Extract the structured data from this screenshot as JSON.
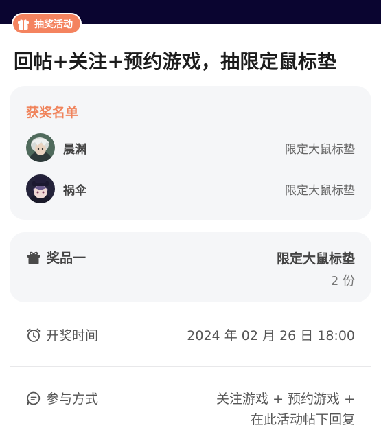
{
  "header": {
    "badge": {
      "label": "抽奖活动",
      "icon": "gift-box-icon",
      "color": "#f4835f"
    },
    "title": "回帖+关注+预约游戏，抽限定鼠标垫"
  },
  "winners": {
    "heading": "获奖名单",
    "items": [
      {
        "name": "晨渊",
        "prize": "限定大鼠标垫",
        "avatar": "avatar-silver-hair-character"
      },
      {
        "name": "祸伞",
        "prize": "限定大鼠标垫",
        "avatar": "avatar-top-hat-character"
      }
    ]
  },
  "prize": {
    "icon": "gift-icon",
    "label": "奖品一",
    "name": "限定大鼠标垫",
    "quantity": "2 份"
  },
  "draw_time": {
    "icon": "alarm-clock-icon",
    "label": "开奖时间",
    "value": "2024 年 02 月 26 日 18:00"
  },
  "participation": {
    "icon": "chat-bubble-icon",
    "label": "参与方式",
    "value_line1": "关注游戏 + 预约游戏 +",
    "value_line2": "在此活动帖下回复"
  },
  "colors": {
    "accent": "#f0845c",
    "card_bg": "#f5f6f8",
    "top_bar": "#0a0530"
  }
}
